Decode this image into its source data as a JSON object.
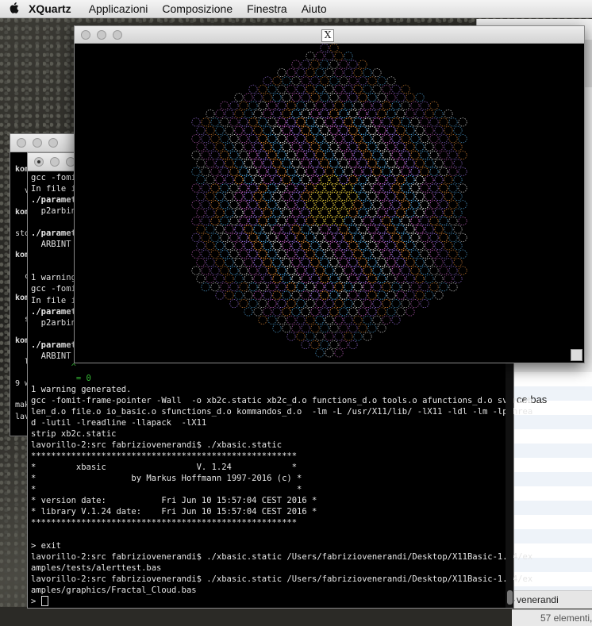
{
  "menubar": {
    "apple": "",
    "app_name": "XQuartz",
    "items": [
      "Applicazioni",
      "Composizione",
      "Finestra",
      "Aiuto"
    ]
  },
  "x11_window": {
    "title_icon": "X",
    "fractal_colors": [
      "#e070e0",
      "#b080ff",
      "#ff9c40",
      "#60c0ff",
      "#ffffff",
      "#ffe040"
    ]
  },
  "back_terminal": {
    "lines": [
      "kom",
      "  v",
      "kom",
      "sto",
      "kom",
      "  c",
      "kom",
      "  s",
      "kom",
      "  l",
      "9 w",
      "mak",
      "lav"
    ]
  },
  "terminal": {
    "lines": [
      "gcc -fomi",
      "In file i",
      "./paramet",
      "  p2arbin",
      "",
      "./paramet",
      "  ARBINT",
      "",
      "",
      "1 warning",
      "gcc -fomi",
      "In file i",
      "./paramet",
      "  p2arbin",
      "",
      "./paramet",
      "  ARBINT",
      "        ^",
      "         = 0",
      "1 warning generated.",
      "gcc -fomit-frame-pointer -Wall  -o xb2c.static xb2c_d.o functions_d.o tools.o afunctions_d.o svariab",
      "len_d.o file.o io_basic.o sfunctions_d.o kommandos_d.o  -lm -L /usr/X11/lib/ -lX11 -ldl -lm -lpthrea",
      "d -lutil -lreadline -llapack  -lX11",
      "strip xb2c.static",
      "lavorillo-2:src fabriziovenerandi$ ./xbasic.static",
      "*****************************************************",
      "*        xbasic                  V. 1.24            *",
      "*                   by Markus Hoffmann 1997-2016 (c) *",
      "*                                                    *",
      "* version date:           Fri Jun 10 15:57:04 CEST 2016 *",
      "* library V.1.24 date:    Fri Jun 10 15:57:04 CEST 2016 *",
      "*****************************************************",
      "",
      "> exit",
      "lavorillo-2:src fabriziovenerandi$ ./xbasic.static /Users/fabriziovenerandi/Desktop/X11Basic-1.24/ex",
      "amples/tests/alerttest.bas",
      "lavorillo-2:src fabriziovenerandi$ ./xbasic.static /Users/fabriziovenerandi/Desktop/X11Basic-1.24/ex",
      "amples/graphics/Fractal_Cloud.bas",
      "> "
    ],
    "bold_lines": [
      2,
      5,
      12,
      15
    ],
    "green_lines": [
      17,
      18
    ]
  },
  "finder": {
    "filename": "ce.bas",
    "path_label": "venerandi",
    "status": "57 elementi,"
  }
}
